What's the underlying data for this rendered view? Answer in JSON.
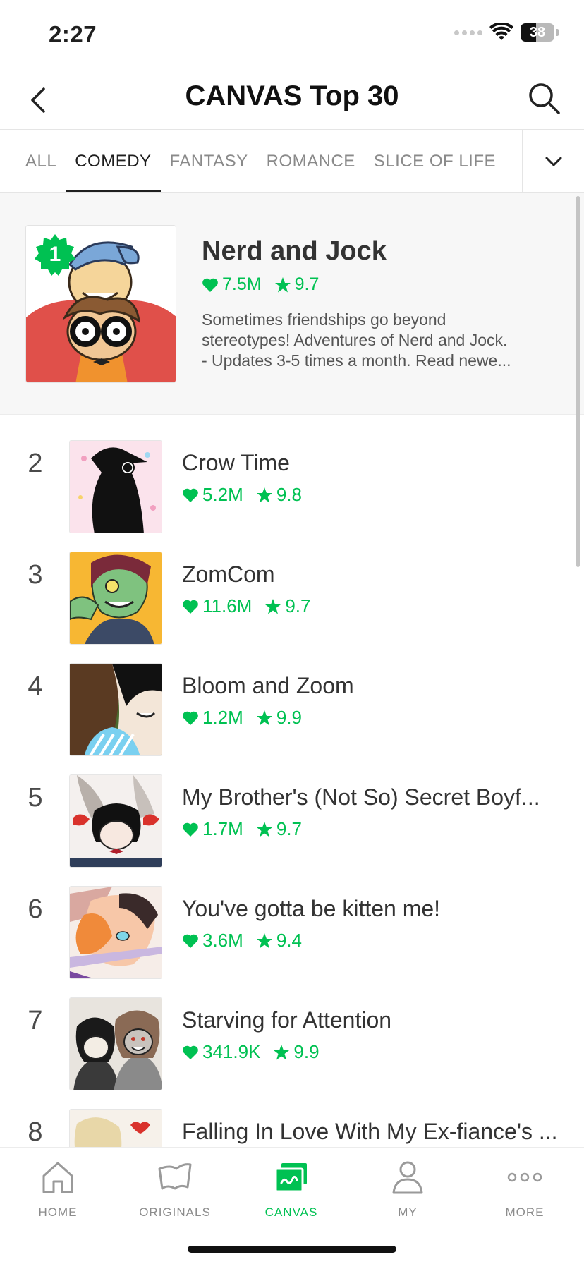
{
  "status_bar": {
    "time": "2:27",
    "battery_level": "38"
  },
  "header": {
    "title": "CANVAS Top 30"
  },
  "tabs": [
    {
      "label": "ALL",
      "active": false
    },
    {
      "label": "COMEDY",
      "active": true
    },
    {
      "label": "FANTASY",
      "active": false
    },
    {
      "label": "ROMANCE",
      "active": false
    },
    {
      "label": "SLICE OF LIFE",
      "active": false
    }
  ],
  "featured": {
    "rank": "1",
    "title": "Nerd and Jock",
    "likes": "7.5M",
    "rating": "9.7",
    "description_lines": [
      "Sometimes friendships go beyond",
      "stereotypes! Adventures of Nerd and Jock.",
      "- Updates 3-5 times a month. Read newe..."
    ]
  },
  "rankings": [
    {
      "rank": "2",
      "title": "Crow Time",
      "likes": "5.2M",
      "rating": "9.8"
    },
    {
      "rank": "3",
      "title": "ZomCom",
      "likes": "11.6M",
      "rating": "9.7"
    },
    {
      "rank": "4",
      "title": "Bloom and Zoom",
      "likes": "1.2M",
      "rating": "9.9"
    },
    {
      "rank": "5",
      "title": "My Brother's (Not So) Secret Boyf...",
      "likes": "1.7M",
      "rating": "9.7"
    },
    {
      "rank": "6",
      "title": "You've gotta be kitten me!",
      "likes": "3.6M",
      "rating": "9.4"
    },
    {
      "rank": "7",
      "title": "Starving for Attention",
      "likes": "341.9K",
      "rating": "9.9"
    },
    {
      "rank": "8",
      "title": "Falling In Love With My Ex-fiance's ...",
      "likes": "",
      "rating": ""
    }
  ],
  "bottom_nav": [
    {
      "label": "HOME",
      "icon": "home-icon",
      "active": false
    },
    {
      "label": "ORIGINALS",
      "icon": "originals-icon",
      "active": false
    },
    {
      "label": "CANVAS",
      "icon": "canvas-icon",
      "active": true
    },
    {
      "label": "MY",
      "icon": "person-icon",
      "active": false
    },
    {
      "label": "MORE",
      "icon": "more-icon",
      "active": false
    }
  ],
  "colors": {
    "accent": "#00c152",
    "text": "#333333",
    "muted": "#8a8a8a"
  }
}
